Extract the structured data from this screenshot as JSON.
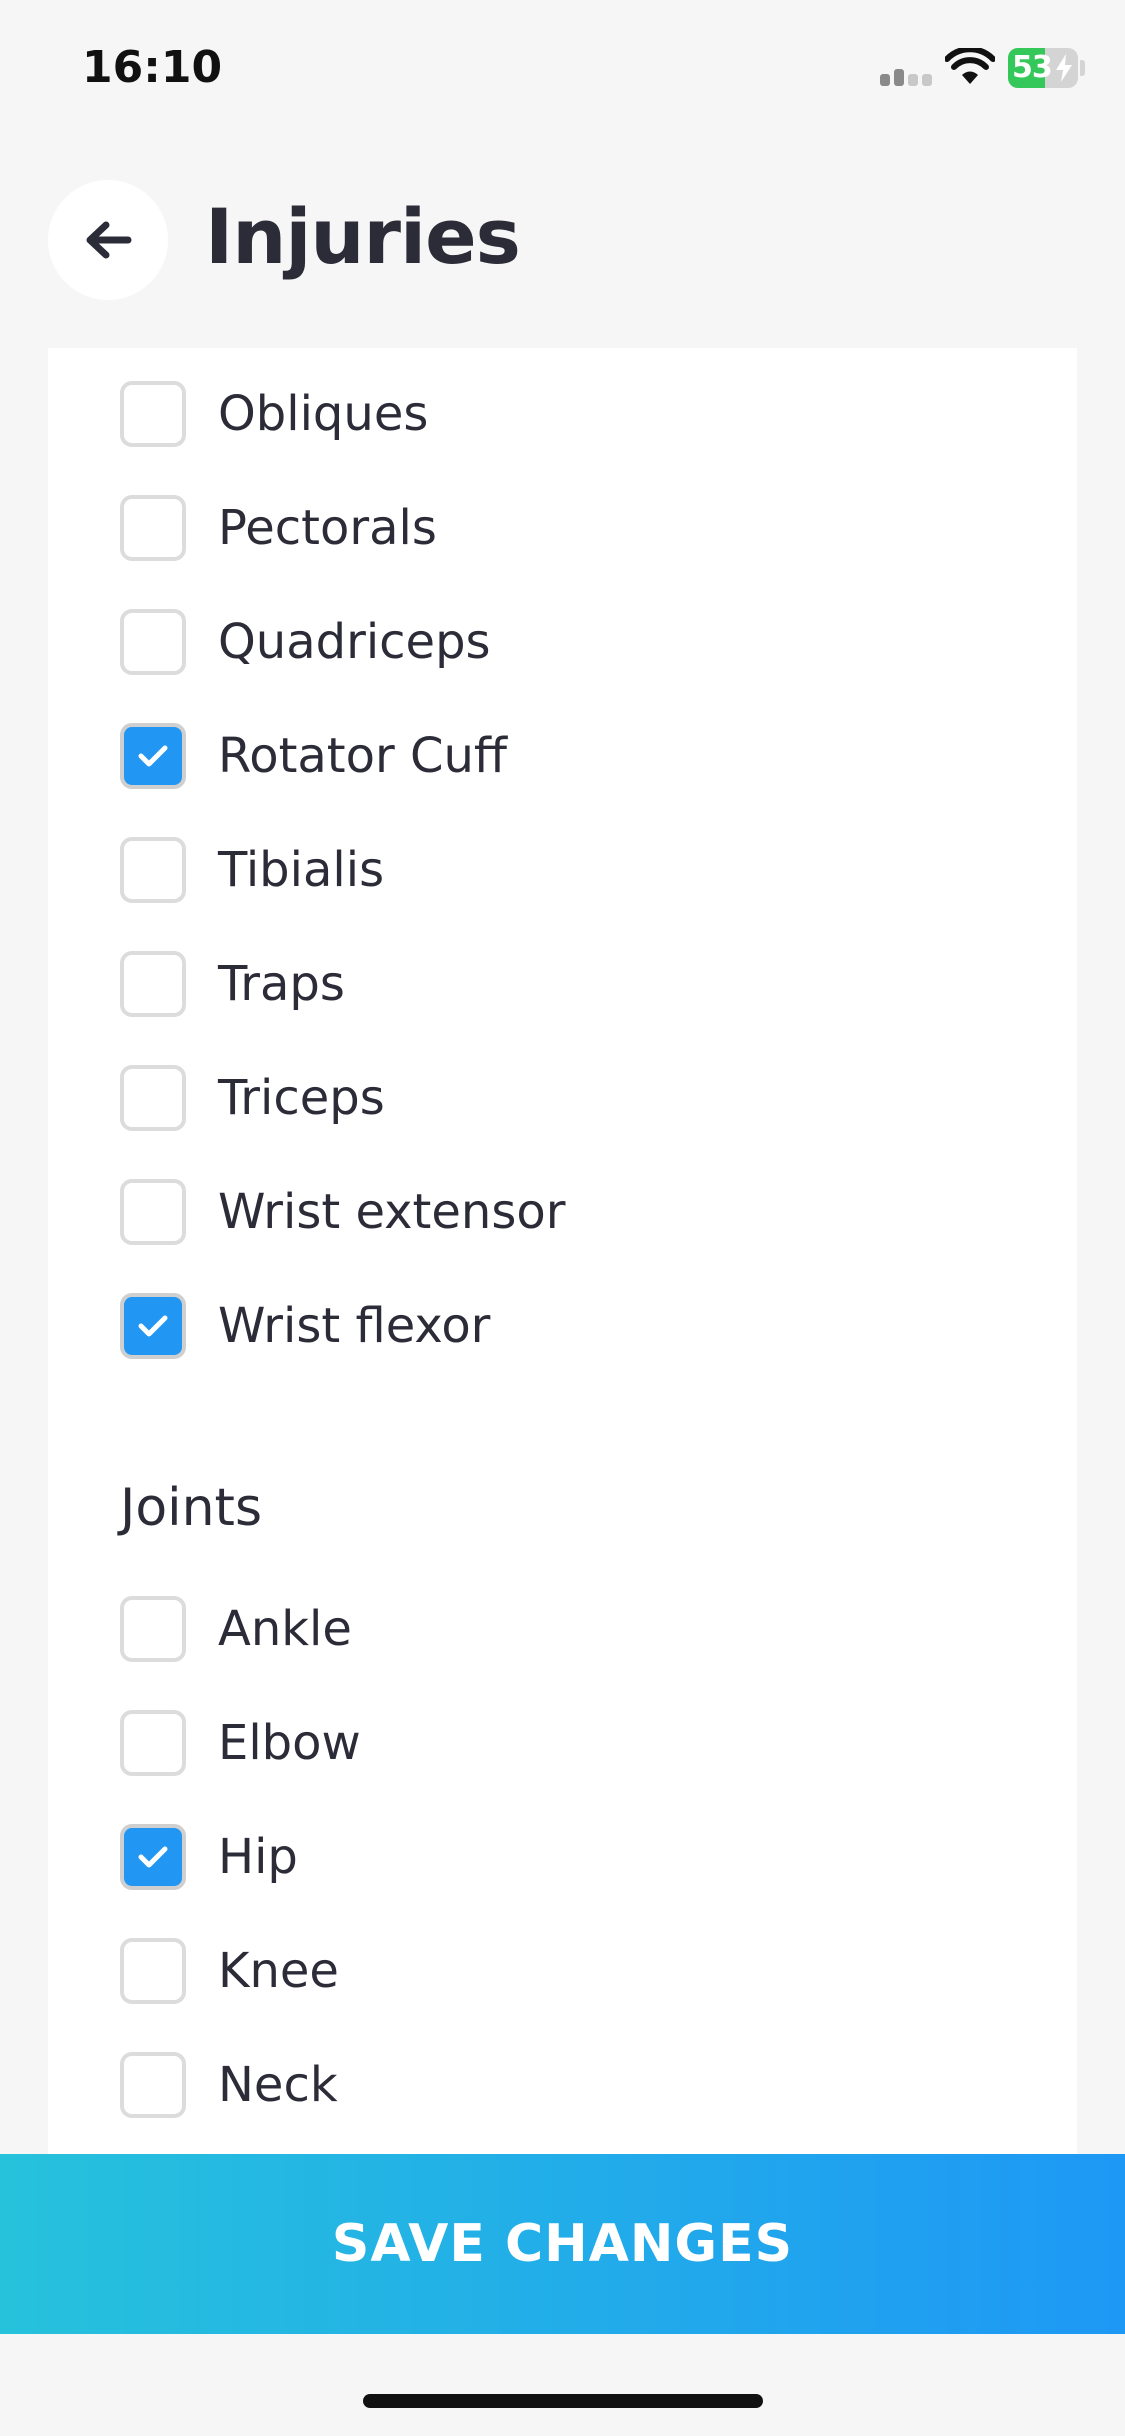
{
  "status_bar": {
    "time": "16:10",
    "battery_percent": "53",
    "battery_level": 0.53,
    "signal_icon": "cellular-signal-icon",
    "wifi_icon": "wifi-icon",
    "battery_icon": "battery-charging-icon"
  },
  "header": {
    "back_icon": "arrow-left-icon",
    "title": "Injuries"
  },
  "muscles": [
    {
      "label": "Obliques",
      "checked": false
    },
    {
      "label": "Pectorals",
      "checked": false
    },
    {
      "label": "Quadriceps",
      "checked": false
    },
    {
      "label": "Rotator Cuff",
      "checked": true
    },
    {
      "label": "Tibialis",
      "checked": false
    },
    {
      "label": "Traps",
      "checked": false
    },
    {
      "label": "Triceps",
      "checked": false
    },
    {
      "label": "Wrist extensor",
      "checked": false
    },
    {
      "label": "Wrist flexor",
      "checked": true
    }
  ],
  "joints_section": {
    "heading": "Joints",
    "items": [
      {
        "label": "Ankle",
        "checked": false
      },
      {
        "label": "Elbow",
        "checked": false
      },
      {
        "label": "Hip",
        "checked": true
      },
      {
        "label": "Knee",
        "checked": false
      },
      {
        "label": "Neck",
        "checked": false
      }
    ]
  },
  "footer": {
    "save_label": "SAVE CHANGES"
  },
  "colors": {
    "accent": "#2196f3",
    "gradient_start": "#26c2dc",
    "gradient_end": "#1e98f5",
    "battery": "#34c759"
  }
}
